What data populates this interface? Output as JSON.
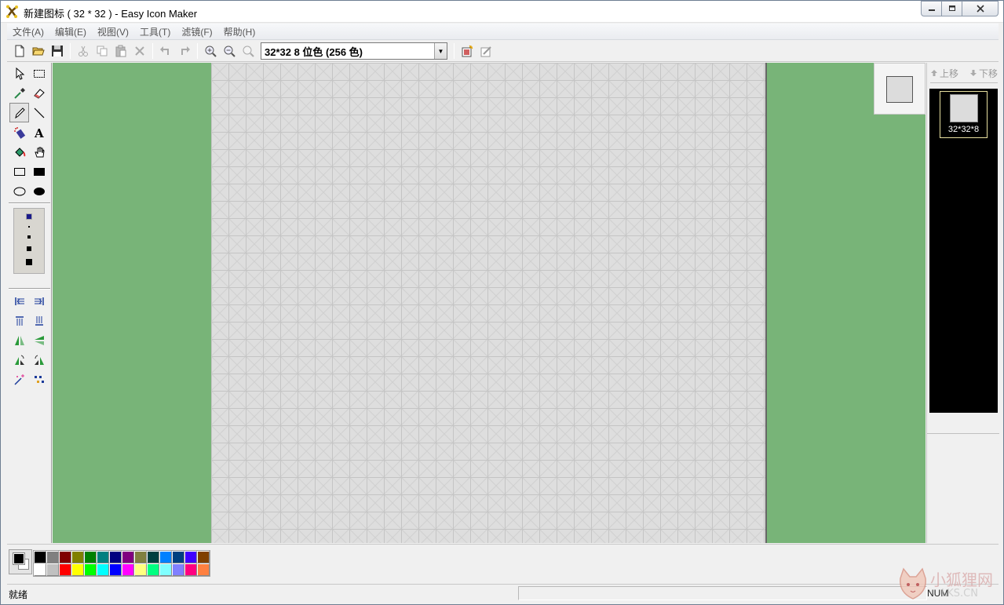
{
  "window": {
    "title": "新建图标 ( 32 * 32 )  - Easy Icon Maker"
  },
  "menu": {
    "items": [
      "文件(A)",
      "编辑(E)",
      "视图(V)",
      "工具(T)",
      "滤镜(F)",
      "帮助(H)"
    ]
  },
  "toolbar": {
    "icon_format": "32*32  8 位色 (256 色)"
  },
  "right_panel": {
    "move_up": "上移",
    "move_down": "下移",
    "icon_entry_label": "32*32*8"
  },
  "palette": {
    "foreground": "#000000",
    "background": "#ffffff",
    "row1": [
      "#000000",
      "#808080",
      "#800000",
      "#808000",
      "#008000",
      "#008080",
      "#000080",
      "#800080",
      "#808040",
      "#004040",
      "#0080ff",
      "#004080",
      "#4000ff",
      "#804000"
    ],
    "row2": [
      "#ffffff",
      "#c0c0c0",
      "#ff0000",
      "#ffff00",
      "#00ff00",
      "#00ffff",
      "#0000ff",
      "#ff00ff",
      "#ffff80",
      "#00ff80",
      "#80ffff",
      "#8080ff",
      "#ff0080",
      "#ff8040"
    ]
  },
  "status": {
    "text": "就绪",
    "num": "NUM"
  },
  "watermark": {
    "text": "小狐狸网",
    "sub": "LKS.CN"
  },
  "colors": {
    "workspace": "#78b478",
    "canvas": "#dedede",
    "icon_list_bg": "#000000"
  }
}
